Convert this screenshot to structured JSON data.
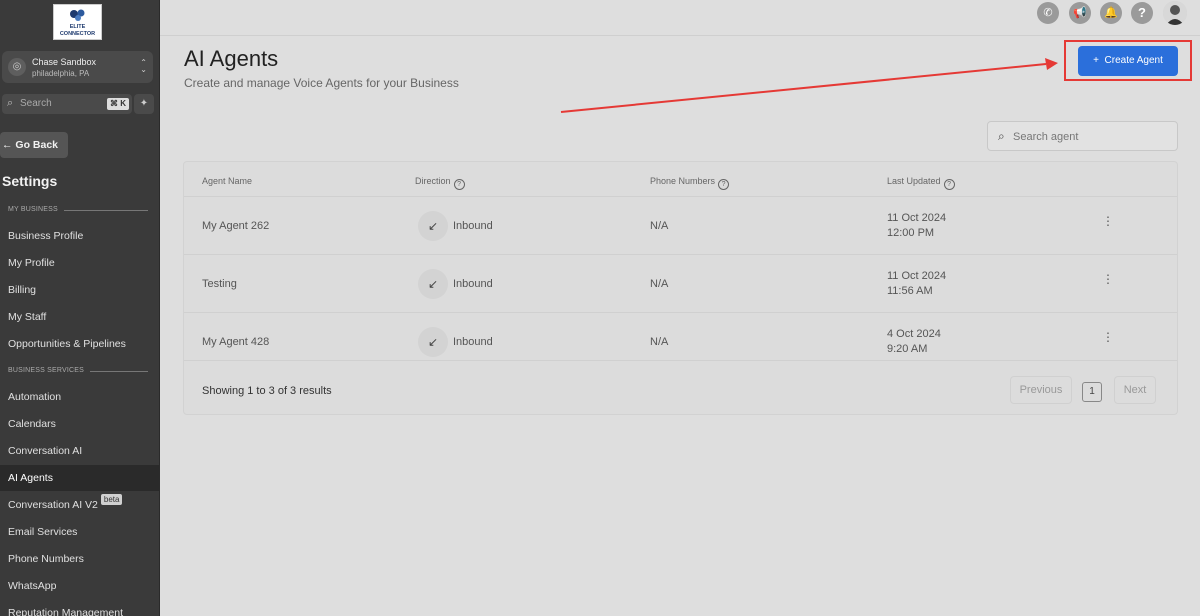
{
  "logo": {
    "line1": "ELITE",
    "line2": "CONNECTOR"
  },
  "account": {
    "name": "Chase Sandbox",
    "location": "philadelphia, PA"
  },
  "sidebar_search": {
    "placeholder": "Search",
    "shortcut": "⌘ K"
  },
  "go_back": "Go Back",
  "settings_title": "Settings",
  "sections": {
    "my_business": "MY BUSINESS",
    "business_services": "BUSINESS SERVICES"
  },
  "nav": {
    "business_profile": "Business Profile",
    "my_profile": "My Profile",
    "billing": "Billing",
    "my_staff": "My Staff",
    "opportunities": "Opportunities & Pipelines",
    "automation": "Automation",
    "calendars": "Calendars",
    "conversation_ai": "Conversation AI",
    "ai_agents": "AI Agents",
    "conversation_ai_v2": "Conversation AI V2",
    "conversation_ai_v2_badge": "beta",
    "email_services": "Email Services",
    "phone_numbers": "Phone Numbers",
    "whatsapp": "WhatsApp",
    "reputation": "Reputation Management"
  },
  "page": {
    "title": "AI Agents",
    "subtitle": "Create and manage Voice Agents for your Business",
    "create_button": "Create Agent",
    "search_placeholder": "Search agent"
  },
  "table": {
    "headers": {
      "name": "Agent Name",
      "direction": "Direction",
      "phones": "Phone Numbers",
      "updated": "Last Updated"
    },
    "rows": [
      {
        "name": "My Agent 262",
        "direction": "Inbound",
        "phones": "N/A",
        "date": "11 Oct 2024",
        "time": "12:00 PM"
      },
      {
        "name": "Testing",
        "direction": "Inbound",
        "phones": "N/A",
        "date": "11 Oct 2024",
        "time": "11:56 AM"
      },
      {
        "name": "My Agent 428",
        "direction": "Inbound",
        "phones": "N/A",
        "date": "4 Oct 2024",
        "time": "9:20 AM"
      }
    ],
    "summary": "Showing 1 to 3 of 3 results",
    "pagination": {
      "previous": "Previous",
      "page": "1",
      "next": "Next"
    }
  },
  "colors": {
    "accent": "#2b6fdb",
    "annotation": "#e53935",
    "sidebar": "#3a3a3a"
  }
}
